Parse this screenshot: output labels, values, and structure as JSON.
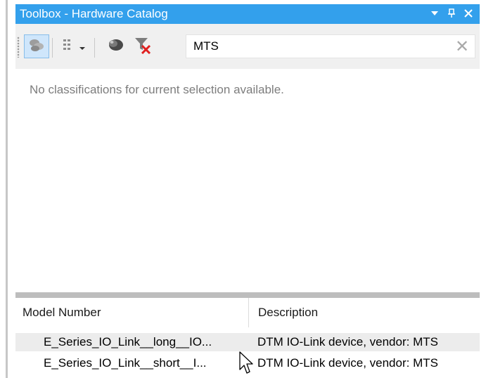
{
  "window": {
    "title": "Toolbox - Hardware Catalog",
    "title_icons": [
      "dropdown-arrow-icon",
      "pin-icon",
      "close-icon"
    ]
  },
  "toolbar": {
    "buttons": [
      {
        "name": "network-view-icon",
        "active": true
      },
      {
        "name": "list-view-icon",
        "has_dropdown": true
      },
      {
        "name": "device-icon"
      },
      {
        "name": "filter-clear-icon"
      }
    ],
    "search": {
      "value": "MTS",
      "clear_glyph": "✕"
    }
  },
  "classification": {
    "empty_message": "No classifications for current selection available."
  },
  "results": {
    "columns": [
      "Model Number",
      "Description"
    ],
    "rows": [
      {
        "model": "E_Series_IO_Link__long__IO...",
        "description": "DTM IO-Link device, vendor: MTS"
      },
      {
        "model": "E_Series_IO_Link__short__I...",
        "description": "DTM IO-Link device, vendor: MTS"
      }
    ]
  },
  "colors": {
    "titlebar": "#33a0ec",
    "toolbar": "#f0f0f0",
    "selected_row": "#ececec"
  }
}
